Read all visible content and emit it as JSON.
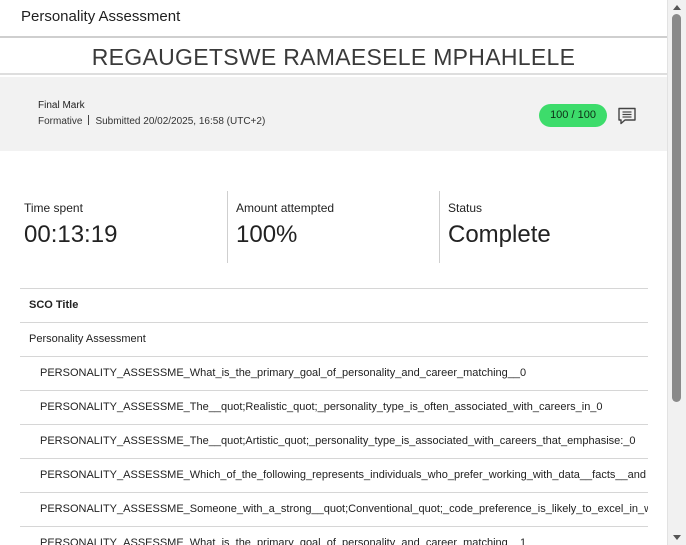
{
  "dialog": {
    "title": "Personality Assessment"
  },
  "student": {
    "name": "REGAUGETSWE RAMAESELE MPHAHLELE"
  },
  "mark": {
    "title": "Final Mark",
    "type": "Formative",
    "submitted": "Submitted 20/02/2025, 16:58 (UTC+2)",
    "score": "100 / 100",
    "score_color": "#3ddc6b",
    "feedback_icon": "comment-icon"
  },
  "stats": [
    {
      "label": "Time spent",
      "value": "00:13:19"
    },
    {
      "label": "Amount attempted",
      "value": "100%"
    },
    {
      "label": "Status",
      "value": "Complete"
    }
  ],
  "sco_table": {
    "header": "SCO Title",
    "parent": "Personality Assessment",
    "rows": [
      "PERSONALITY_ASSESSME_What_is_the_primary_goal_of_personality_and_career_matching__0",
      "PERSONALITY_ASSESSME_The__quot;Realistic_quot;_personality_type_is_often_associated_with_careers_in_0",
      "PERSONALITY_ASSESSME_The__quot;Artistic_quot;_personality_type_is_associated_with_careers_that_emphasise:_0",
      "PERSONALITY_ASSESSME_Which_of_the_following_represents_individuals_who_prefer_working_with_data__facts__and",
      "PERSONALITY_ASSESSME_Someone_with_a_strong__quot;Conventional_quot;_code_preference_is_likely_to_excel_in_w",
      "PERSONALITY_ASSESSME_What_is_the_primary_goal_of_personality_and_career_matching__1"
    ]
  }
}
